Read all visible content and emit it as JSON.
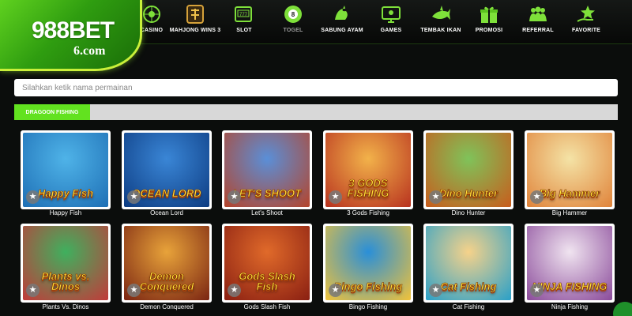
{
  "brand": {
    "name": "988BET",
    "domain": "6.com",
    "accent": "#62e21f"
  },
  "nav": {
    "items": [
      {
        "label": "CASINO",
        "icon": "roulette-icon"
      },
      {
        "label": "MAHJONG WINS 3",
        "icon": "mahjong-icon"
      },
      {
        "label": "SLOT",
        "icon": "slot-machine-icon"
      },
      {
        "label": "TOGEL",
        "icon": "lottery-ball-icon"
      },
      {
        "label": "SABUNG AYAM",
        "icon": "rooster-icon"
      },
      {
        "label": "GAMES",
        "icon": "monitor-icon"
      },
      {
        "label": "TEMBAK IKAN",
        "icon": "shark-icon"
      },
      {
        "label": "PROMOSI",
        "icon": "gift-icon"
      },
      {
        "label": "REFERRAL",
        "icon": "people-icon"
      },
      {
        "label": "FAVORITE",
        "icon": "star-hand-icon"
      }
    ]
  },
  "search": {
    "placeholder": "Silahkan ketik nama permainan"
  },
  "category": {
    "active_label": "DRAGOON FISHING"
  },
  "games": [
    {
      "name": "Happy Fish",
      "art_title": "Happy Fish",
      "bg": "#4fb3e8",
      "bg2": "#1e6fb5"
    },
    {
      "name": "Ocean Lord",
      "art_title": "OCEAN LORD",
      "bg": "#3a86d6",
      "bg2": "#0d3c82"
    },
    {
      "name": "Let's Shoot",
      "art_title": "LET'S SHOOT",
      "bg": "#5a8fd8",
      "bg2": "#b5442a"
    },
    {
      "name": "3 Gods Fishing",
      "art_title": "3 GODS FISHING",
      "bg": "#f2b24a",
      "bg2": "#b8321f"
    },
    {
      "name": "Dino Hunter",
      "art_title": "Dino Hunter",
      "bg": "#7fc35a",
      "bg2": "#c85c1c"
    },
    {
      "name": "Big Hammer",
      "art_title": "Big Hammer",
      "bg": "#f4e3a6",
      "bg2": "#e0833a"
    },
    {
      "name": "Plants Vs. Dinos",
      "art_title": "Plants vs. Dinos",
      "bg": "#3fb05e",
      "bg2": "#c23a3a"
    },
    {
      "name": "Demon Conquered",
      "art_title": "Demon Conquered",
      "bg": "#e8a33a",
      "bg2": "#7a2412"
    },
    {
      "name": "Gods Slash Fish",
      "art_title": "Gods Slash Fish",
      "bg": "#e06a2a",
      "bg2": "#8a1f12"
    },
    {
      "name": "Bingo Fishing",
      "art_title": "Bingo Fishing",
      "bg": "#2a8fd8",
      "bg2": "#f0c23a"
    },
    {
      "name": "Cat Fishing",
      "art_title": "Cat Fishing",
      "bg": "#f6d28a",
      "bg2": "#2aa0c8"
    },
    {
      "name": "Ninja Fishing",
      "art_title": "NINJA FISHING",
      "bg": "#f0e4f0",
      "bg2": "#8a4a9a"
    }
  ],
  "fav_icon": "star-icon"
}
